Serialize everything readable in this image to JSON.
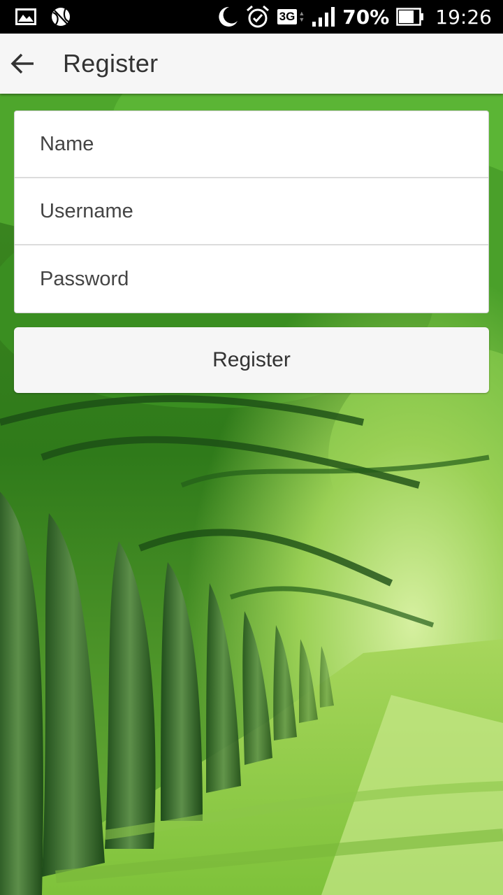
{
  "status_bar": {
    "network": "3G",
    "battery": "70%",
    "time": "19:26",
    "icons": [
      "gallery-icon",
      "ball-icon",
      "moon-icon",
      "alarm-icon",
      "signal-icon",
      "battery-icon"
    ]
  },
  "app_bar": {
    "title": "Register",
    "back_icon": "arrow-left-icon"
  },
  "form": {
    "name_placeholder": "Name",
    "username_placeholder": "Username",
    "password_placeholder": "Password",
    "submit_label": "Register"
  },
  "colors": {
    "app_bar": "#f6f6f6",
    "status_bar": "#000000",
    "field_divider": "#dcdcdc"
  }
}
